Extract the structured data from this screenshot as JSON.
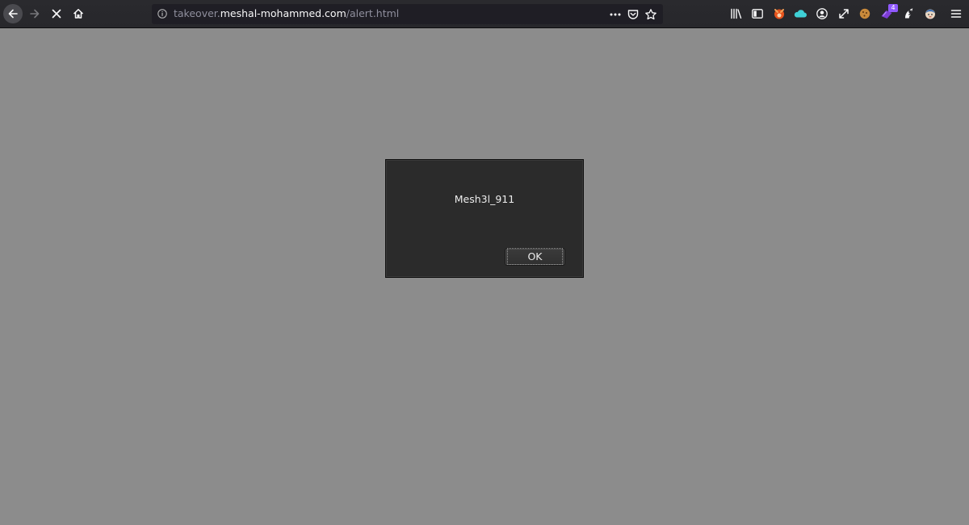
{
  "browser": {
    "url": {
      "prefix": "takeover.",
      "host": "meshal-mohammed.com",
      "path": "/alert.html"
    },
    "url_actions": [
      "more-actions-icon",
      "pocket-icon",
      "bookmark-star-icon"
    ],
    "toolbar_icons": [
      "library-icon",
      "sidebar-icon",
      "fox-extension-icon",
      "cloud-extension-icon",
      "account-icon",
      "resize-extension-icon",
      "cookie-extension-icon",
      "purple-extension-icon",
      "ninja-extension-icon",
      "avatar-extension-icon",
      "menu-icon"
    ],
    "badge_count": "4",
    "colors": {
      "toolbar": "#2a2a2e",
      "urlbar": "#1f1e25",
      "badge": "#9059ff"
    }
  },
  "alert": {
    "message": "Mesh3l_911",
    "ok_label": "OK"
  },
  "page": {
    "background": "#8c8c8c"
  }
}
